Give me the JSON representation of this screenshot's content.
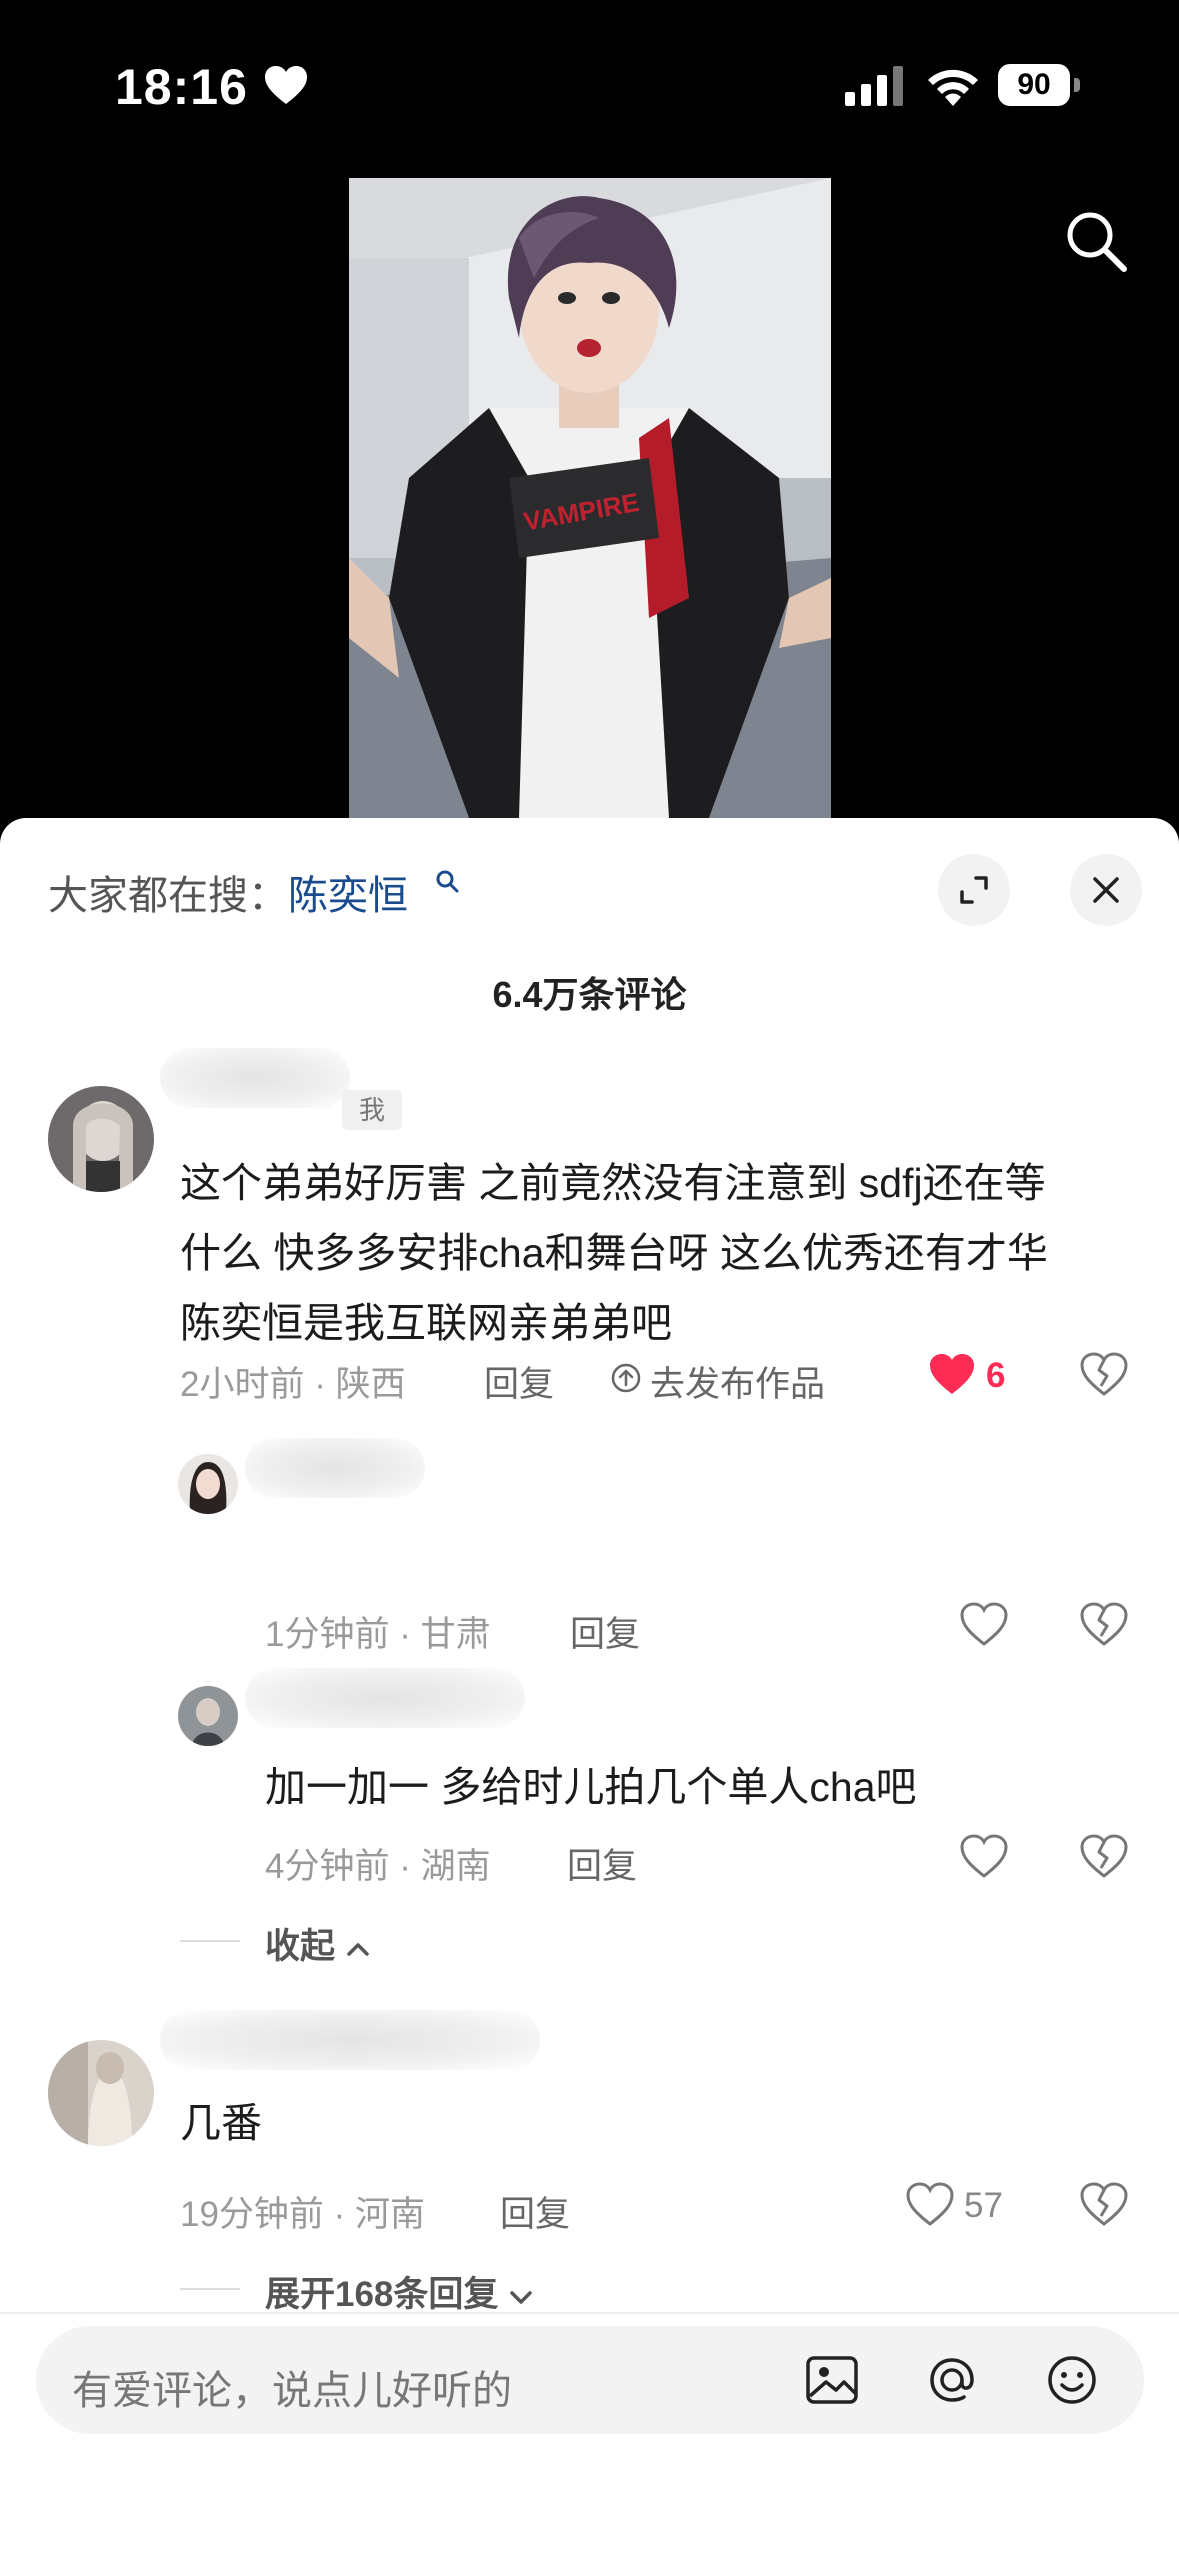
{
  "status": {
    "time": "18:16",
    "battery": "90"
  },
  "panel": {
    "hot_label": "大家都在搜：",
    "hot_term": "陈奕恒",
    "comment_count": "6.4万条评论"
  },
  "comments": [
    {
      "me_tag": "我",
      "text": [
        "这个弟弟好厉害 之前竟然没有注意到 sdfj还在等",
        "什么 快多多安排cha和舞台呀 这么优秀还有才华",
        "陈奕恒是我互联网亲弟弟吧"
      ],
      "meta": "2小时前 · 陕西",
      "reply": "回复",
      "publish": "去发布作品",
      "likes": "6"
    },
    {
      "meta": "1分钟前 · 甘肃",
      "reply": "回复"
    },
    {
      "text": "加一加一 多给时儿拍几个单人cha吧",
      "meta": "4分钟前 · 湖南",
      "reply": "回复"
    },
    {
      "text": "几番",
      "meta": "19分钟前 · 河南",
      "reply": "回复",
      "likes": "57"
    }
  ],
  "collapse_label": "收起",
  "expand_label": "展开168条回复",
  "input": {
    "placeholder": "有爱评论，说点儿好听的"
  },
  "colors": {
    "like_red": "#fe2c55",
    "hot_term": "#1a4b8c"
  },
  "icons": [
    "heart-icon",
    "signal-icon",
    "wifi-icon",
    "search-icon",
    "expand-icon",
    "close-icon",
    "like-icon",
    "dislike-icon",
    "image-icon",
    "at-icon",
    "emoji-icon"
  ]
}
